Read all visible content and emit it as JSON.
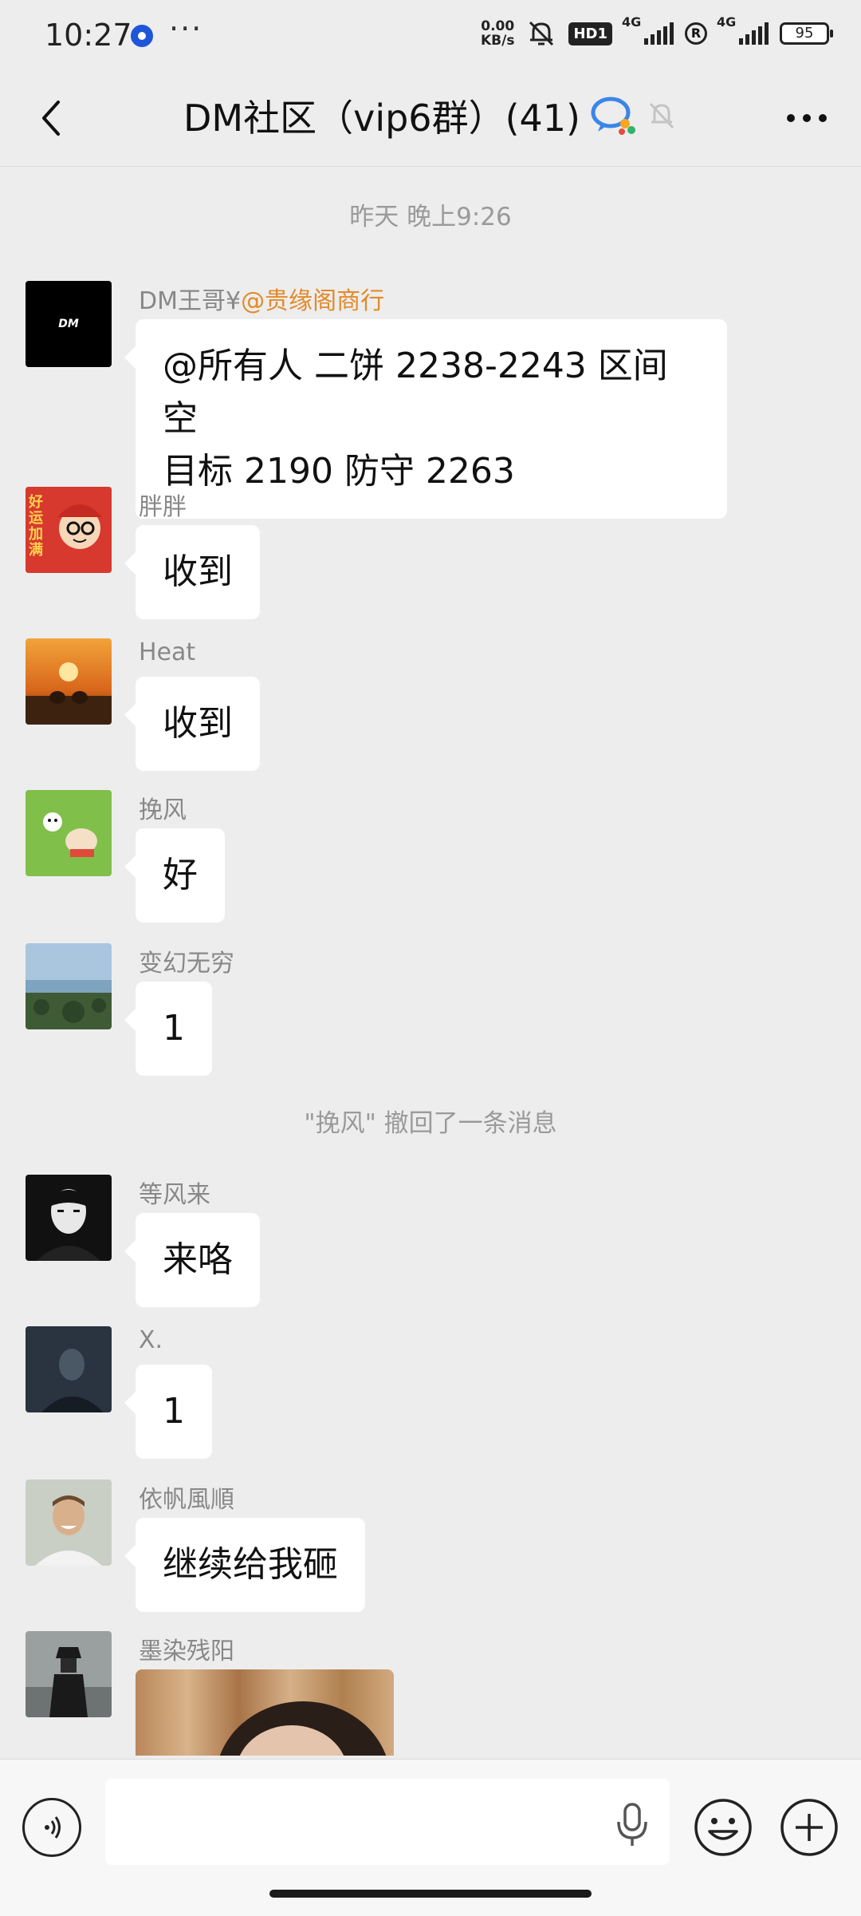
{
  "status_bar": {
    "time": "10:27",
    "more": "···",
    "net_speed_value": "0.00",
    "net_speed_unit": "KB/s",
    "hd_badge": "HD1",
    "signal1_label": "4G",
    "signal2_label": "4G",
    "r_mark": "R",
    "battery": "95"
  },
  "header": {
    "title": "DM社区（vip6群）(41)"
  },
  "chat": {
    "timestamp": "昨天 晚上9:26",
    "recall_notice": "\"挽风\" 撤回了一条消息",
    "messages": [
      {
        "sender": "DM王哥¥",
        "mention": "@贵缘阁商行",
        "line1": "@所有人 二饼 2238-2243 区间 空",
        "line2": "目标 2190 防守 2263",
        "avatar_text": "DM"
      },
      {
        "sender": "胖胖",
        "text": "收到",
        "avatar_text": "好运加满"
      },
      {
        "sender": "Heat",
        "text": "收到"
      },
      {
        "sender": "挽风",
        "text": "好"
      },
      {
        "sender": "变幻无穷",
        "text": "1"
      },
      {
        "sender": "等风来",
        "text": "来咯"
      },
      {
        "sender": "X.",
        "text": "1"
      },
      {
        "sender": "依帆風順",
        "text": "继续给我砸"
      },
      {
        "sender": "墨染残阳"
      }
    ]
  },
  "input_bar": {
    "placeholder": ""
  },
  "colors": {
    "background": "#ededed",
    "bubble": "#ffffff",
    "mention": "#e28a2a"
  }
}
